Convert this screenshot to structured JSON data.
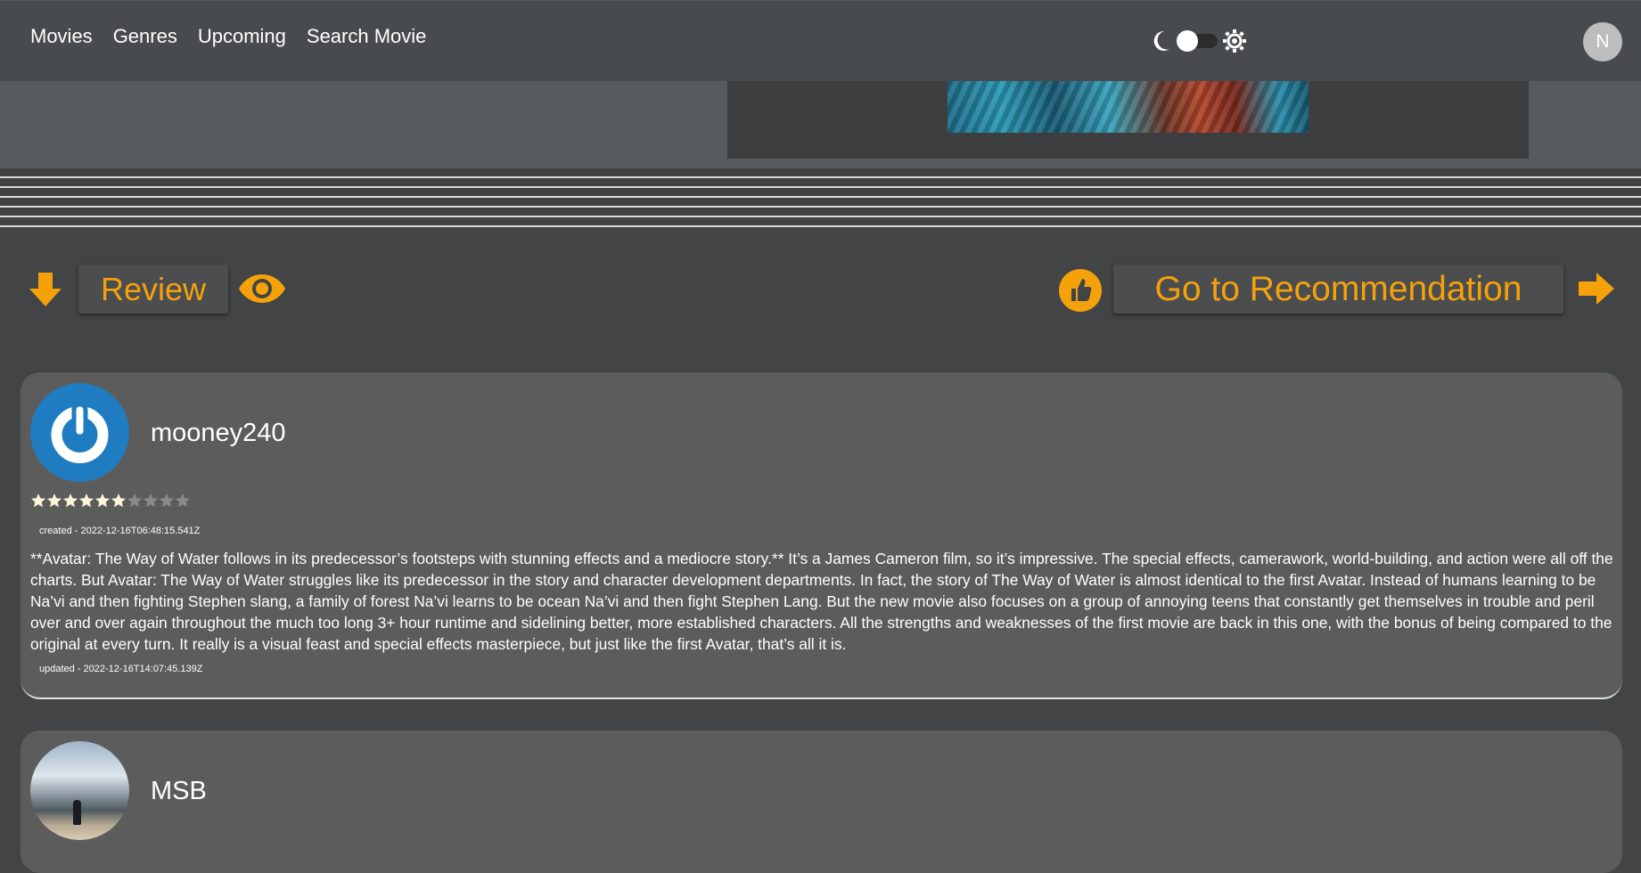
{
  "nav": {
    "links": [
      "Movies",
      "Genres",
      "Upcoming",
      "Search Movie"
    ],
    "user_initial": "N",
    "theme_toggle": {
      "left_icon": "moon-icon",
      "right_icon": "sun-icon",
      "state": "dark"
    }
  },
  "actions": {
    "review_label": "Review",
    "recommendation_label": "Go to Recommendation",
    "accent_color": "#f5a20a"
  },
  "reviews": [
    {
      "author": "mooney240",
      "rating": 6,
      "rating_max": 10,
      "created": "created - 2022-12-16T06:48:15.541Z",
      "content": "**Avatar: The Way of Water follows in its predecessor’s footsteps with stunning effects and a mediocre story.** It’s a James Cameron film, so it’s impressive. The special effects, camerawork, world-building, and action were all off the charts. But Avatar: The Way of Water struggles like its predecessor in the story and character development departments. In fact, the story of The Way of Water is almost identical to the first Avatar. Instead of humans learning to be Na’vi and then fighting Stephen slang, a family of forest Na’vi learns to be ocean Na’vi and then fight Stephen Lang. But the new movie also focuses on a group of annoying teens that constantly get themselves in trouble and peril over and over again throughout the much too long 3+ hour runtime and sidelining better, more established characters. All the strengths and weaknesses of the first movie are back in this one, with the bonus of being compared to the original at every turn. It really is a visual feast and special effects masterpiece, but just like the first Avatar, that’s all it is.",
      "updated": "updated - 2022-12-16T14:07:45.139Z"
    },
    {
      "author": "MSB"
    }
  ]
}
